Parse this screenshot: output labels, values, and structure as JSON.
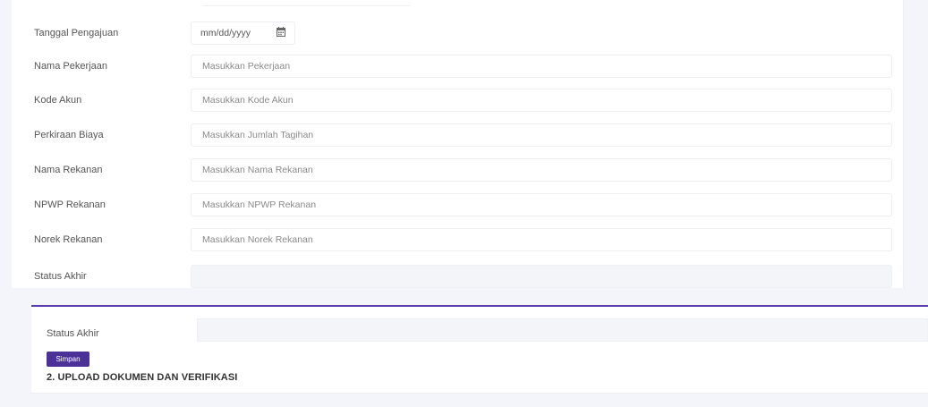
{
  "form": {
    "fields": [
      {
        "label": "Tanggal Pengajuan",
        "value": "mm/dd/yyyy"
      },
      {
        "label": "Nama Pekerjaan",
        "placeholder": "Masukkan Pekerjaan"
      },
      {
        "label": "Kode Akun",
        "placeholder": "Masukkan Kode Akun"
      },
      {
        "label": "Perkiraan Biaya",
        "placeholder": "Masukkan Jumlah Tagihan"
      },
      {
        "label": "Nama Rekanan",
        "placeholder": "Masukkan Nama Rekanan"
      },
      {
        "label": "NPWP Rekanan",
        "placeholder": "Masukkan NPWP Rekanan"
      },
      {
        "label": "Norek Rekanan",
        "placeholder": "Masukkan Norek Rekanan"
      },
      {
        "label": "Status Akhir",
        "placeholder": ""
      }
    ]
  },
  "bottom": {
    "status_label": "Status Akhir",
    "save_label": "Simpan",
    "section_title": "2. UPLOAD DOKUMEN DAN VERIFIKASI"
  },
  "icons": {
    "date": "calendar-icon"
  },
  "colors": {
    "primary": "#4c3199",
    "accent_line": "#5b3fb0"
  }
}
